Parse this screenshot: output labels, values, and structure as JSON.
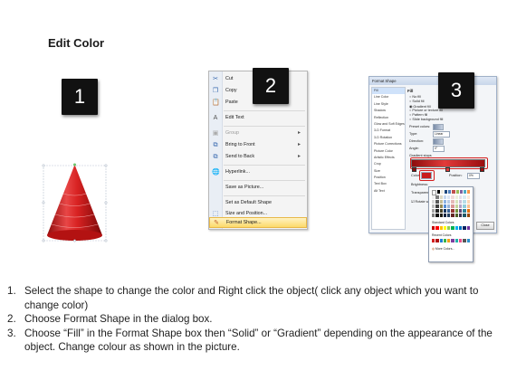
{
  "title": "Edit Color",
  "badges": [
    "1",
    "2",
    "3"
  ],
  "colors": {
    "cone_light": "#f07070",
    "cone_dark": "#b81414",
    "badge": "#111111",
    "highlight": "#fcd96a"
  },
  "context_menu": {
    "items": [
      {
        "icon": "cut-icon",
        "label": "Cut"
      },
      {
        "icon": "copy-icon",
        "label": "Copy"
      },
      {
        "icon": "paste-icon",
        "label": "Paste"
      },
      {
        "icon": "edit-text-icon",
        "label": "Edit Text"
      },
      {
        "icon": "group-icon",
        "label": "Group"
      },
      {
        "icon": "bring-front-icon",
        "label": "Bring to Front"
      },
      {
        "icon": "send-back-icon",
        "label": "Send to Back"
      },
      {
        "icon": "hyperlink-icon",
        "label": "Hyperlink..."
      },
      {
        "icon": "",
        "label": "Save as Picture..."
      },
      {
        "icon": "",
        "label": "Set as Default Shape"
      },
      {
        "icon": "size-icon",
        "label": "Size and Position..."
      },
      {
        "icon": "format-shape-icon",
        "label": "Format Shape..."
      }
    ]
  },
  "dialog": {
    "title": "Format Shape",
    "categories": [
      "Fill",
      "Line Color",
      "Line Style",
      "Shadow",
      "Reflection",
      "Glow and Soft Edges",
      "3-D Format",
      "3-D Rotation",
      "Picture Corrections",
      "Picture Color",
      "Artistic Effects",
      "Crop",
      "Size",
      "Position",
      "Text Box",
      "Alt Text"
    ],
    "fill_heading": "Fill",
    "options": [
      "No fill",
      "Solid fill",
      "Gradient fill",
      "Picture or texture fill",
      "Pattern fill",
      "Slide background fill"
    ],
    "preset_label": "Preset colors:",
    "type_label": "Type:",
    "type_value": "Linear",
    "direction_label": "Direction:",
    "angle_label": "Angle:",
    "angle_value": "0°",
    "stops_label": "Gradient stops",
    "color_label": "Color",
    "position_label": "Position:",
    "position_value": "0%",
    "brightness_label": "Brightness:",
    "transparency_label": "Transparency:",
    "rotate_label": "Rotate with shape",
    "close_label": "Close",
    "palette_standard": "Standard Colors",
    "palette_recent": "Recent Colors",
    "palette_more": "More Colors..."
  },
  "steps": [
    {
      "num": "1.",
      "text": "Select the shape to change the color and Right click the object( click any object which you want to change color)"
    },
    {
      "num": "2.",
      "text": "Choose Format Shape in the dialog box."
    },
    {
      "num": "3.",
      "text": "Choose “Fill” in the Format Shape box then “Solid” or “Gradient” depending on the appearance of the object. Change colour as shown in the picture."
    }
  ]
}
